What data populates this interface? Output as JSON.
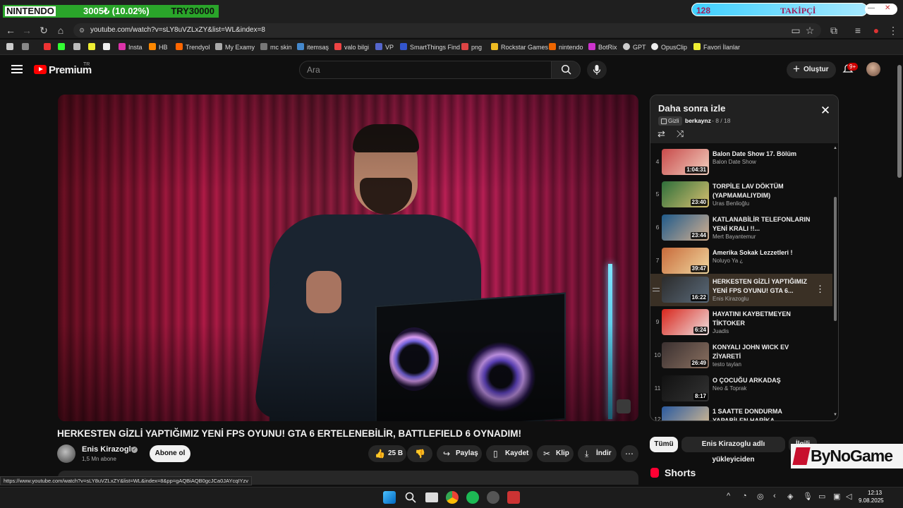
{
  "overlay": {
    "nintendo_label": "NINTENDO",
    "nintendo_progress": "3005₺ (10.02%)",
    "nintendo_goal": "TRY30000",
    "follow_count": "128",
    "follow_label": "TAKİPÇİ"
  },
  "browser": {
    "url": "youtube.com/watch?v=sLY8uVZLxZY&list=WL&index=8",
    "bookmarks": [
      "Insta",
      "HB",
      "Trendyol",
      "My Examy",
      "mc skin",
      "itemsaş",
      "valo bilgi",
      "VP",
      "SmartThings Find",
      "png",
      "Rockstar Games",
      "nintendo",
      "BotRix",
      "GPT",
      "OpusClip",
      "Favori İlanlar"
    ],
    "status_url": "https://www.youtube.com/watch?v=sLY8uVZLxZY&list=WL&index=8&pp=gAQBiAQB0gcJCa0JAYcqIYzv"
  },
  "header": {
    "brand": "Premium",
    "region": "TR",
    "search_placeholder": "Ara",
    "create_label": "Oluştur",
    "notif_badge": "9+"
  },
  "video": {
    "title": "HERKESTEN GİZLİ YAPTIĞIMIZ YENİ FPS OYUNU! GTA 6 ERTELENEBİLİR, BATTLEFIELD 6 OYNADIM!",
    "channel": "Enis Kirazoglu",
    "subscribers": "1,5 Mn abone",
    "subscribe_label": "Abone ol",
    "likes": "25 B",
    "share_label": "Paylaş",
    "save_label": "Kaydet",
    "clip_label": "Klip",
    "download_label": "İndir"
  },
  "playlist": {
    "title": "Daha sonra izle",
    "privacy": "Gizli",
    "owner": "berkaynz",
    "position": "- 8 / 18",
    "items": [
      {
        "index": "4",
        "title": "Balon Date Show 17. Bölüm",
        "channel": "Balon Date Show",
        "duration": "1:04:31"
      },
      {
        "index": "5",
        "title": "TORPİLE LAV DÖKTÜM (YAPMAMALIYDIM)",
        "channel": "Uras Benlioğlu",
        "duration": "23:40"
      },
      {
        "index": "6",
        "title": "KATLANABİLİR TELEFONLARIN YENİ KRALI !!...",
        "channel": "Mert Bayantemur",
        "duration": "23:44"
      },
      {
        "index": "7",
        "title": "Amerika Sokak Lezzetleri !",
        "channel": "Noluyo Ya ¿",
        "duration": "39:47"
      },
      {
        "index": "",
        "title": "HERKESTEN GİZLİ YAPTIĞIMIZ YENİ FPS OYUNU! GTA 6...",
        "channel": "Enis Kirazoglu",
        "duration": "16:22"
      },
      {
        "index": "9",
        "title": "HAYATINI KAYBETMEYEN TİKTOKER",
        "channel": "Juadis",
        "duration": "6:24"
      },
      {
        "index": "10",
        "title": "KONYALI JOHN WICK EV ZİYARETİ",
        "channel": "testo taylan",
        "duration": "26:49"
      },
      {
        "index": "11",
        "title": "O ÇOCUĞU ARKADAŞ",
        "channel": "Neo & Toprak",
        "duration": "8:17"
      },
      {
        "index": "12",
        "title": "1 SAATTE DONDURMA YAPABİLEN HARİKA...",
        "channel": "",
        "duration": ""
      }
    ]
  },
  "chips": [
    "Tümü",
    "Enis Kirazoglu adlı yükleyiciden",
    "İlgili"
  ],
  "shorts_label": "Shorts",
  "watermark": "ByNoGame",
  "taskbar": {
    "time": "12:13",
    "date": "9.08.2025"
  },
  "colors": {
    "accent": "#ff0000",
    "active_row": "#3a3025",
    "background": "#0f0f0f"
  }
}
